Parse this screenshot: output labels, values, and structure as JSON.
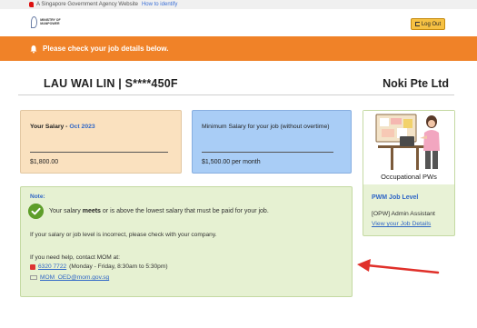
{
  "masthead": {
    "agency_text": "A Singapore Government Agency Website",
    "identify_link": "How to identify"
  },
  "header": {
    "logo_text": "MINISTRY OF MANPOWER",
    "logout_label": "Log Out"
  },
  "banner": {
    "text": "Please check your job details below."
  },
  "identity": {
    "name_nric": "LAU WAI LIN | S****450F",
    "company": "Noki Pte Ltd"
  },
  "salary_card": {
    "label": "Your Salary - ",
    "month": "Oct 2023",
    "amount": "$1,800.00"
  },
  "min_card": {
    "label": "Minimum Salary for your job (without overtime)",
    "amount": "$1,500.00 per month"
  },
  "note": {
    "title": "Note:",
    "meets_prefix": "Your salary ",
    "meets_bold": "meets",
    "meets_suffix": " or is above the lowest salary that must be paid for your job.",
    "incorrect": "If your salary or job level is incorrect, please check with your company.",
    "help": "If you need help, contact MOM at:",
    "phone": "6320 7722",
    "phone_hours": " (Monday - Friday, 8:30am to 5:30pm)",
    "email": "MOM_OED@mom.gov.sg"
  },
  "pw_card": {
    "caption": "Occupational PWs",
    "level_title": "PWM Job Level",
    "role": "[OPW] Admin Assistant",
    "link": "View your Job Details"
  },
  "colors": {
    "banner": "#f08228",
    "salary": "#fae1bf",
    "minimum": "#a9cdf6",
    "note": "#e6f1d2",
    "link": "#2f66c6",
    "arrow": "#e0302a"
  }
}
